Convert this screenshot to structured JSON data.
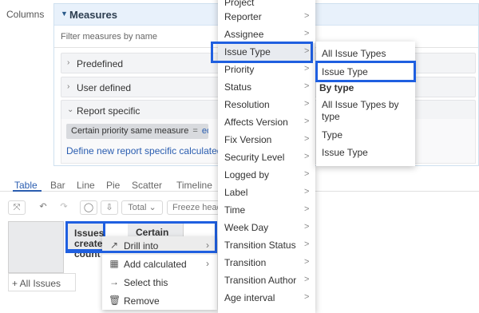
{
  "columns_label": "Columns",
  "measures": {
    "title": "Measures",
    "filter_placeholder": "Filter measures by name",
    "sections": [
      "Predefined",
      "User defined",
      "Report specific"
    ],
    "chip": {
      "name": "Certain priority same measure",
      "eq": "=",
      "edit": "edit"
    },
    "define_link": "Define new report specific calculated measure"
  },
  "chart_tabs": [
    "Table",
    "Bar",
    "Line",
    "Pie",
    "Scatter",
    "Timeline"
  ],
  "toolbar": {
    "total": "Total",
    "freeze": "Freeze header"
  },
  "table": {
    "col1": "Issues created count",
    "col2": "Certain",
    "row1": "+ All Issues"
  },
  "context_menu": [
    {
      "icon": "↗",
      "label": "Drill into",
      "arrow": "›"
    },
    {
      "icon": "▦",
      "label": "Add calculated",
      "arrow": "›"
    },
    {
      "icon": "→",
      "label": "Select this",
      "arrow": ""
    },
    {
      "icon": "🗑",
      "label": "Remove",
      "arrow": ""
    }
  ],
  "dimension_menu": [
    "Project",
    "Reporter",
    "Assignee",
    "Issue Type",
    "Priority",
    "Status",
    "Resolution",
    "Affects Version",
    "Fix Version",
    "Security Level",
    "Logged by",
    "Label",
    "Time",
    "Week Day",
    "Transition Status",
    "Transition",
    "Transition Author",
    "Age interval"
  ],
  "dimension_arrow": ">",
  "type_menu": {
    "all_types": "All Issue Types",
    "issue_type": "Issue Type",
    "by_type": "By type",
    "all_by_type": "All Issue Types by type",
    "type": "Type",
    "issue_type2": "Issue Type"
  }
}
